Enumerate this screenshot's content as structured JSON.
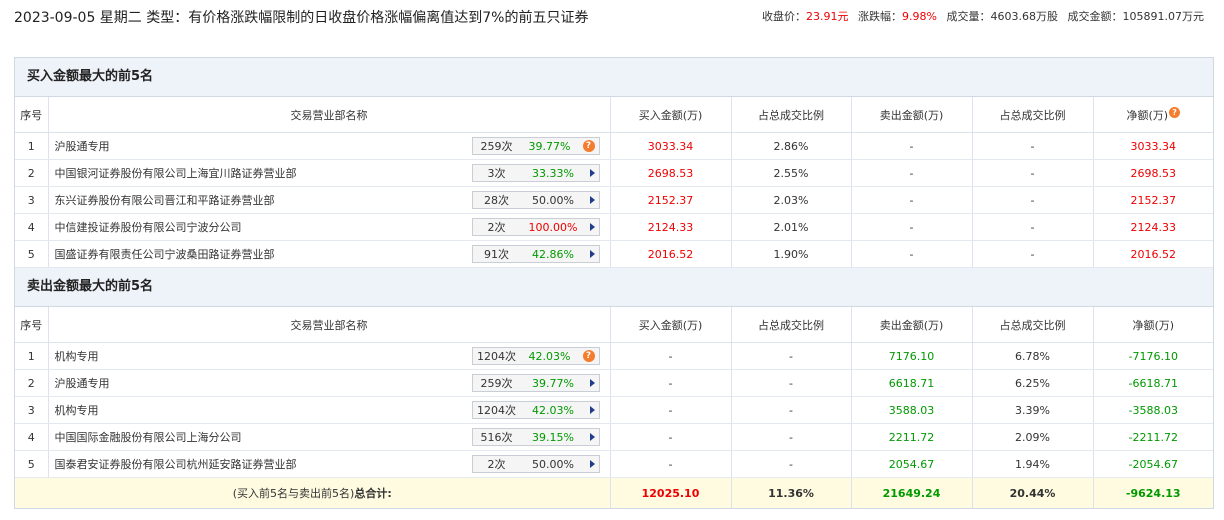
{
  "header": {
    "title": "2023-09-05 星期二 类型：有价格涨跌幅限制的日收盘价格涨幅偏离值达到7%的前五只证券",
    "stats": [
      {
        "label": "收盘价：",
        "value": "23.91元",
        "color": "red"
      },
      {
        "label": "涨跌幅：",
        "value": "9.98%",
        "color": "red"
      },
      {
        "label": "成交量：",
        "value": "4603.68万股",
        "color": "plain"
      },
      {
        "label": "成交金额：",
        "value": "105891.07万元",
        "color": "plain"
      }
    ]
  },
  "columns": [
    "序号",
    "交易营业部名称",
    "买入金额(万)",
    "占总成交比例",
    "卖出金额(万)",
    "占总成交比例",
    "净额(万)"
  ],
  "buy_section": {
    "title": "买入金额最大的前5名",
    "rows": [
      {
        "idx": "1",
        "name": "沪股通专用",
        "count": "259次",
        "pct": "39.77%",
        "pct_color": "green",
        "icon": "question",
        "buy": "3033.34",
        "buy_ratio": "2.86%",
        "sell": "-",
        "sell_ratio": "-",
        "net": "3033.34"
      },
      {
        "idx": "2",
        "name": "中国银河证券股份有限公司上海宜川路证券营业部",
        "count": "3次",
        "pct": "33.33%",
        "pct_color": "green",
        "icon": "arrow",
        "buy": "2698.53",
        "buy_ratio": "2.55%",
        "sell": "-",
        "sell_ratio": "-",
        "net": "2698.53"
      },
      {
        "idx": "3",
        "name": "东兴证券股份有限公司晋江和平路证券营业部",
        "count": "28次",
        "pct": "50.00%",
        "pct_color": "plain",
        "icon": "arrow",
        "buy": "2152.37",
        "buy_ratio": "2.03%",
        "sell": "-",
        "sell_ratio": "-",
        "net": "2152.37"
      },
      {
        "idx": "4",
        "name": "中信建投证券股份有限公司宁波分公司",
        "count": "2次",
        "pct": "100.00%",
        "pct_color": "red",
        "icon": "arrow",
        "buy": "2124.33",
        "buy_ratio": "2.01%",
        "sell": "-",
        "sell_ratio": "-",
        "net": "2124.33"
      },
      {
        "idx": "5",
        "name": "国盛证券有限责任公司宁波桑田路证券营业部",
        "count": "91次",
        "pct": "42.86%",
        "pct_color": "green",
        "icon": "arrow",
        "buy": "2016.52",
        "buy_ratio": "1.90%",
        "sell": "-",
        "sell_ratio": "-",
        "net": "2016.52"
      }
    ]
  },
  "sell_section": {
    "title": "卖出金额最大的前5名",
    "rows": [
      {
        "idx": "1",
        "name": "机构专用",
        "count": "1204次",
        "pct": "42.03%",
        "pct_color": "green",
        "icon": "question",
        "buy": "-",
        "buy_ratio": "-",
        "sell": "7176.10",
        "sell_ratio": "6.78%",
        "net": "-7176.10"
      },
      {
        "idx": "2",
        "name": "沪股通专用",
        "count": "259次",
        "pct": "39.77%",
        "pct_color": "green",
        "icon": "arrow",
        "buy": "-",
        "buy_ratio": "-",
        "sell": "6618.71",
        "sell_ratio": "6.25%",
        "net": "-6618.71"
      },
      {
        "idx": "3",
        "name": "机构专用",
        "count": "1204次",
        "pct": "42.03%",
        "pct_color": "green",
        "icon": "arrow",
        "buy": "-",
        "buy_ratio": "-",
        "sell": "3588.03",
        "sell_ratio": "3.39%",
        "net": "-3588.03"
      },
      {
        "idx": "4",
        "name": "中国国际金融股份有限公司上海分公司",
        "count": "516次",
        "pct": "39.15%",
        "pct_color": "green",
        "icon": "arrow",
        "buy": "-",
        "buy_ratio": "-",
        "sell": "2211.72",
        "sell_ratio": "2.09%",
        "net": "-2211.72"
      },
      {
        "idx": "5",
        "name": "国泰君安证券股份有限公司杭州延安路证券营业部",
        "count": "2次",
        "pct": "50.00%",
        "pct_color": "plain",
        "icon": "arrow",
        "buy": "-",
        "buy_ratio": "-",
        "sell": "2054.67",
        "sell_ratio": "1.94%",
        "net": "-2054.67"
      }
    ]
  },
  "total": {
    "label_prefix": "(买入前5名与卖出前5名)",
    "label_bold": "总合计:",
    "buy": "12025.10",
    "buy_ratio": "11.36%",
    "sell": "21649.24",
    "sell_ratio": "20.44%",
    "net": "-9624.13"
  },
  "colors": {
    "red": "#e00000",
    "green": "#009900",
    "accent_orange": "#f47c2c",
    "header_bg": "#eef2f9",
    "total_bg": "#fffbe0"
  }
}
